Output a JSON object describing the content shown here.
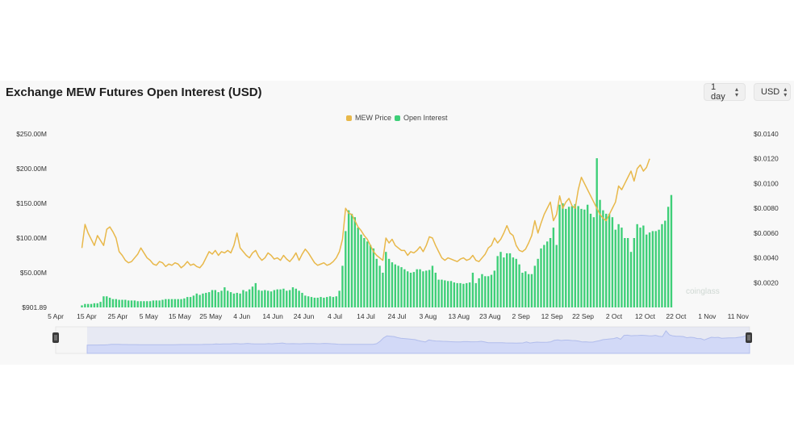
{
  "header": {
    "title": "Exchange MEW Futures Open Interest (USD)"
  },
  "controls": {
    "interval": "1 day",
    "currency": "USD"
  },
  "colors": {
    "price": "#e8b84a",
    "oi": "#3ecf78",
    "navigator_fill": "#dfe4fb",
    "navigator_line": "#b9c4ee"
  },
  "chart_data": {
    "type": "bar",
    "title": "Exchange MEW Futures Open Interest (USD)",
    "legend": [
      "MEW Price",
      "Open Interest"
    ],
    "legend_position": "top-center",
    "grid": false,
    "x_ticks": [
      "5 Apr",
      "15 Apr",
      "25 Apr",
      "5 May",
      "15 May",
      "25 May",
      "4 Jun",
      "14 Jun",
      "24 Jun",
      "4 Jul",
      "14 Jul",
      "24 Jul",
      "3 Aug",
      "13 Aug",
      "23 Aug",
      "2 Sep",
      "12 Sep",
      "22 Sep",
      "2 Oct",
      "12 Oct",
      "22 Oct",
      "1 Nov",
      "11 Nov"
    ],
    "y_left_ticks": [
      "$901.89",
      "$50.00M",
      "$100.00M",
      "$150.00M",
      "$200.00M",
      "$250.00M"
    ],
    "y_left_range": [
      0,
      250
    ],
    "y_left_unit": "M USD",
    "y_right_ticks": [
      "$0.0020",
      "$0.0040",
      "$0.0060",
      "$0.0080",
      "$0.0100",
      "$0.0120",
      "$0.0140"
    ],
    "y_right_range": [
      0.0,
      0.014
    ],
    "series": [
      {
        "name": "Open Interest",
        "type": "bar",
        "axis": "left",
        "description_unit": "millions USD, daily from 14 Apr",
        "start_date": "14 Apr",
        "values": [
          3,
          5,
          5,
          5,
          6,
          6,
          8,
          16,
          16,
          14,
          12,
          12,
          11,
          11,
          11,
          10,
          10,
          10,
          9,
          9,
          9,
          9,
          9,
          10,
          10,
          10,
          11,
          12,
          12,
          12,
          12,
          12,
          12,
          13,
          15,
          15,
          17,
          20,
          18,
          20,
          21,
          22,
          25,
          25,
          22,
          24,
          29,
          24,
          22,
          20,
          21,
          20,
          25,
          23,
          26,
          30,
          35,
          25,
          24,
          25,
          24,
          23,
          25,
          26,
          26,
          27,
          24,
          25,
          29,
          27,
          24,
          21,
          17,
          16,
          15,
          14,
          14,
          15,
          14,
          15,
          16,
          15,
          16,
          24,
          60,
          110,
          140,
          135,
          130,
          115,
          105,
          100,
          95,
          90,
          85,
          70,
          60,
          50,
          80,
          70,
          65,
          62,
          60,
          58,
          55,
          52,
          50,
          51,
          55,
          55,
          52,
          53,
          54,
          60,
          50,
          40,
          40,
          39,
          38,
          38,
          36,
          35,
          35,
          34,
          35,
          36,
          50,
          35,
          42,
          48,
          45,
          45,
          47,
          53,
          74,
          80,
          72,
          78,
          78,
          72,
          70,
          62,
          50,
          52,
          48,
          48,
          60,
          70,
          85,
          90,
          95,
          100,
          115,
          90,
          148,
          150,
          142,
          145,
          146,
          149,
          146,
          142,
          141,
          148,
          135,
          130,
          215,
          155,
          140,
          135,
          135,
          130,
          112,
          120,
          115,
          100,
          100,
          80,
          100,
          120,
          115,
          118,
          105,
          108,
          110,
          110,
          112,
          120,
          125,
          145,
          162
        ]
      },
      {
        "name": "MEW Price",
        "type": "line",
        "axis": "right",
        "values": [
          0.0048,
          0.0067,
          0.006,
          0.0055,
          0.005,
          0.0058,
          0.0054,
          0.005,
          0.0063,
          0.0065,
          0.0061,
          0.0056,
          0.0045,
          0.0042,
          0.0038,
          0.0036,
          0.0037,
          0.004,
          0.0043,
          0.0048,
          0.0044,
          0.004,
          0.0038,
          0.0035,
          0.0034,
          0.0037,
          0.0036,
          0.0033,
          0.0035,
          0.0034,
          0.0036,
          0.0035,
          0.0032,
          0.0034,
          0.0037,
          0.0034,
          0.0035,
          0.0033,
          0.0032,
          0.0035,
          0.004,
          0.0045,
          0.0043,
          0.0046,
          0.0042,
          0.0045,
          0.0044,
          0.0046,
          0.0044,
          0.005,
          0.006,
          0.0048,
          0.0045,
          0.0042,
          0.004,
          0.0044,
          0.0046,
          0.0041,
          0.0038,
          0.004,
          0.0044,
          0.0042,
          0.0039,
          0.004,
          0.0038,
          0.0042,
          0.0039,
          0.0037,
          0.004,
          0.0044,
          0.0038,
          0.0043,
          0.0047,
          0.0044,
          0.004,
          0.0036,
          0.0034,
          0.0035,
          0.0036,
          0.0034,
          0.0035,
          0.0037,
          0.004,
          0.0045,
          0.0055,
          0.008,
          0.0076,
          0.0075,
          0.007,
          0.0065,
          0.0062,
          0.0058,
          0.0055,
          0.005,
          0.0045,
          0.0042,
          0.004,
          0.0038,
          0.0056,
          0.0052,
          0.0055,
          0.005,
          0.0048,
          0.0046,
          0.0046,
          0.0042,
          0.0045,
          0.0044,
          0.0046,
          0.0049,
          0.0045,
          0.005,
          0.0057,
          0.0056,
          0.005,
          0.0045,
          0.004,
          0.0038,
          0.004,
          0.0039,
          0.0038,
          0.0037,
          0.0039,
          0.004,
          0.0038,
          0.0039,
          0.0042,
          0.0038,
          0.0037,
          0.004,
          0.0043,
          0.0048,
          0.005,
          0.0056,
          0.0052,
          0.0055,
          0.006,
          0.0066,
          0.006,
          0.0058,
          0.005,
          0.0046,
          0.0045,
          0.0047,
          0.0052,
          0.0058,
          0.007,
          0.006,
          0.0068,
          0.0075,
          0.008,
          0.0085,
          0.007,
          0.0075,
          0.009,
          0.008,
          0.0085,
          0.0088,
          0.0082,
          0.008,
          0.0095,
          0.0105,
          0.01,
          0.0095,
          0.009,
          0.0085,
          0.008,
          0.0075,
          0.0072,
          0.007,
          0.0075,
          0.008,
          0.0085,
          0.0098,
          0.0095,
          0.01,
          0.0105,
          0.011,
          0.0102,
          0.0112,
          0.0115,
          0.011,
          0.0113,
          0.012
        ]
      }
    ]
  },
  "watermark": "coinglass"
}
